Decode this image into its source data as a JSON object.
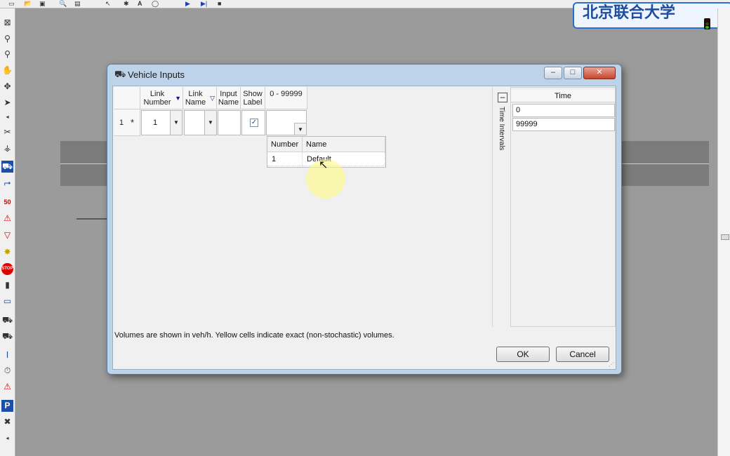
{
  "app": {
    "toolbar_icons": [
      "new-icon",
      "open-icon",
      "save-icon",
      "print-preview-icon",
      "print-icon",
      "select-icon",
      "text-icon",
      "rotate-icon",
      "play-icon",
      "step-icon",
      "stop-icon"
    ],
    "text_tool_label": "A",
    "left_toolbar_icons": [
      "network-icon",
      "zoom-icon",
      "zoom-query-icon",
      "pan-icon",
      "rotate3d-icon",
      "links-icon",
      "arrow-small-icon",
      "link-tool-icon",
      "connector-icon",
      "vehicle-input-icon",
      "routes-icon",
      "speed-50-icon",
      "warning-icon",
      "yield-icon",
      "priority-icon",
      "stop-sign-icon",
      "signal-head-icon",
      "detector-icon",
      "transit-stop-icon",
      "transit-line-icon",
      "travel-time-icon",
      "queue-counter-icon",
      "node-icon",
      "parking-icon",
      "cross-icon",
      "arrow-small-icon"
    ],
    "left_labels": {
      "speed": "50",
      "stop": "STOP",
      "parking": "P"
    },
    "banner_text": "北京联合大学"
  },
  "dialog": {
    "title": "Vehicle Inputs",
    "window_buttons": {
      "minimize": "–",
      "maximize": "□",
      "close": "✕"
    },
    "columns": [
      {
        "label": "Link Number",
        "filter": "filter-active-icon"
      },
      {
        "label": "Link Name",
        "filter": "filter-icon"
      },
      {
        "label": "Input Name"
      },
      {
        "label": "Show Label"
      },
      {
        "label": "0 - 99999"
      }
    ],
    "row": {
      "index": "1",
      "new_row_marker": "*",
      "link_number": "1",
      "link_name": "",
      "input_name": "",
      "show_label": true,
      "volume": ""
    },
    "popup": {
      "headers": [
        "Number",
        "Name"
      ],
      "rows": [
        {
          "number": "1",
          "name": "Default"
        }
      ]
    },
    "status_text": "Volumes are shown in veh/h. Yellow cells indicate exact (non-stochastic) volumes.",
    "side_panel_label": "Time Intervals",
    "collapse_label": "–",
    "time_header": "Time",
    "time_values": [
      "0",
      "99999"
    ],
    "ok_label": "OK",
    "cancel_label": "Cancel"
  }
}
